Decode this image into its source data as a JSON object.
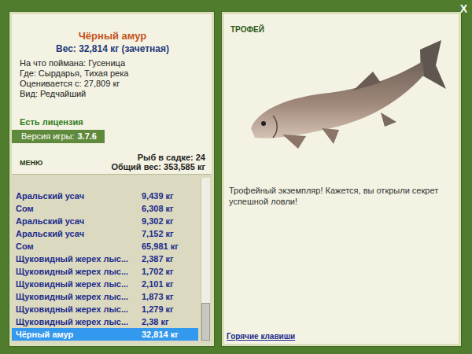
{
  "window": {
    "close": "X"
  },
  "fish_card": {
    "title": "Чёрный амур",
    "weight": "Вес: 32,814 кг (зачетная)",
    "details": [
      "На что поймана: Гусеница",
      "Где: Сырдарья, Тихая река",
      "Оценивается с: 27,809 кг",
      "Вид: Редчайший"
    ],
    "license": "Есть лицензия",
    "version_label": "Версия игры:",
    "version": "3.7.6"
  },
  "menu": {
    "label": "МЕНЮ",
    "count": "Рыб в садке: 24",
    "total": "Общий вес: 353,585 кг"
  },
  "catch_list": {
    "rows": [
      {
        "name": "Аральский усач",
        "weight": "9,439 кг",
        "selected": false
      },
      {
        "name": "Сом",
        "weight": "6,308 кг",
        "selected": false
      },
      {
        "name": "Аральский усач",
        "weight": "9,302 кг",
        "selected": false
      },
      {
        "name": "Аральский усач",
        "weight": "7,152 кг",
        "selected": false
      },
      {
        "name": "Сом",
        "weight": "65,981 кг",
        "selected": false
      },
      {
        "name": "Щуковидный жерех лыс...",
        "weight": "2,387 кг",
        "selected": false
      },
      {
        "name": "Щуковидный жерех лыс...",
        "weight": "1,702 кг",
        "selected": false
      },
      {
        "name": "Щуковидный жерех лыс...",
        "weight": "2,101 кг",
        "selected": false
      },
      {
        "name": "Щуковидный жерех лыс...",
        "weight": "1,873 кг",
        "selected": false
      },
      {
        "name": "Щуковидный жерех лыс...",
        "weight": "1,279 кг",
        "selected": false
      },
      {
        "name": "Щуковидный жерех лыс...",
        "weight": "2,38 кг",
        "selected": false
      },
      {
        "name": "Чёрный амур",
        "weight": "32,814 кг",
        "selected": true
      }
    ],
    "scrollbar": {
      "level": 1
    }
  },
  "trophy": {
    "label": "ТРОФЕЙ",
    "message": "Трофейный экземпляр! Кажется, вы открыли секрет успешной ловли!",
    "hotkeys": "Горячие клавиши"
  }
}
